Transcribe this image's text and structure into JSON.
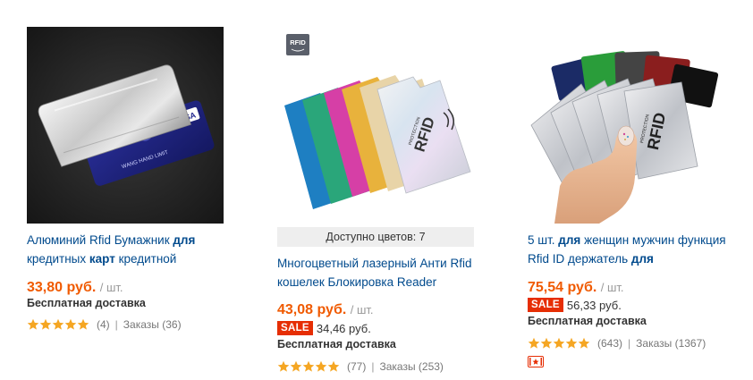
{
  "products": [
    {
      "title_parts": [
        {
          "text": "Алюминий Rfid Бумажник ",
          "bold": false
        },
        {
          "text": "для",
          "bold": true
        },
        {
          "text": " кредитных ",
          "bold": false
        },
        {
          "text": "карт",
          "bold": true
        },
        {
          "text": " кредитной",
          "bold": false
        }
      ],
      "price": "33,80 руб.",
      "unit": "/ шт.",
      "shipping": "Бесплатная доставка",
      "rating": 5,
      "feedback": "(4)",
      "separator": "|",
      "orders": "Заказы (36)",
      "card_label": "VISA",
      "card_name": "WANG HAND LIMIT",
      "image_alt": "aluminium-rfid-sleeve-photo"
    },
    {
      "badge": "RFID",
      "colors_available": "Доступно цветов: 7",
      "title_parts": [
        {
          "text": "Многоцветный лазерный Анти Rfid кошелек Блокировка Reader",
          "bold": false
        }
      ],
      "price": "43,08 руб.",
      "unit": "/ шт.",
      "sale_label": "SALE",
      "sale_price": "34,46 руб.",
      "shipping": "Бесплатная доставка",
      "rating": 5,
      "feedback": "(77)",
      "separator": "|",
      "orders": "Заказы (253)",
      "sleeve_label": "RFID",
      "sleeve_sub": "PROTECTION",
      "image_alt": "multicolor-rfid-sleeves-photo"
    },
    {
      "title_parts": [
        {
          "text": "5 шт. ",
          "bold": false
        },
        {
          "text": "для",
          "bold": true
        },
        {
          "text": " женщин мужчин функция Rfid ID держатель ",
          "bold": false
        },
        {
          "text": "для",
          "bold": true
        }
      ],
      "price": "75,54 руб.",
      "unit": "/ шт.",
      "sale_label": "SALE",
      "sale_price": "56,33 руб.",
      "shipping": "Бесплатная доставка",
      "rating": 5,
      "feedback": "(643)",
      "separator": "|",
      "orders": "Заказы (1367)",
      "sleeve_label": "RFID",
      "sleeve_sub": "PROTECTION",
      "image_alt": "hand-holding-rfid-sleeves-photo",
      "extra_icon": "video-badge-icon"
    }
  ],
  "colors": {
    "title": "#004a8d",
    "price": "#f05a00",
    "sale": "#e62e04",
    "star": "#f5a623"
  }
}
